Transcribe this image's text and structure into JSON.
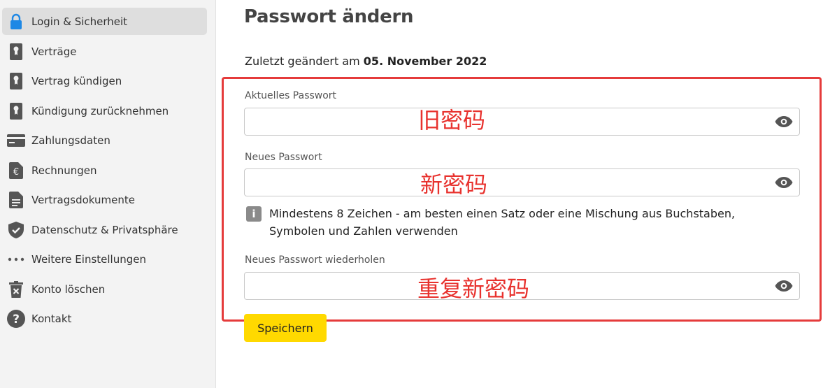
{
  "sidebar": {
    "items": [
      {
        "label": "Login & Sicherheit",
        "icon": "lock-icon",
        "active": true
      },
      {
        "label": "Verträge",
        "icon": "contract-icon"
      },
      {
        "label": "Vertrag kündigen",
        "icon": "contract-icon"
      },
      {
        "label": "Kündigung zurücknehmen",
        "icon": "contract-icon"
      },
      {
        "label": "Zahlungsdaten",
        "icon": "credit-card-icon"
      },
      {
        "label": "Rechnungen",
        "icon": "euro-document-icon"
      },
      {
        "label": "Vertragsdokumente",
        "icon": "document-icon"
      },
      {
        "label": "Datenschutz & Privatsphäre",
        "icon": "shield-check-icon"
      },
      {
        "label": "Weitere Einstellungen",
        "icon": "more-dots-icon"
      },
      {
        "label": "Konto löschen",
        "icon": "trash-icon"
      },
      {
        "label": "Kontakt",
        "icon": "help-icon"
      }
    ]
  },
  "main": {
    "title": "Passwort ändern",
    "last_changed_prefix": "Zuletzt geändert am",
    "last_changed_date": "05. November 2022",
    "fields": {
      "current": {
        "label": "Aktuelles Passwort",
        "value": "",
        "annotation": "旧密码"
      },
      "new": {
        "label": "Neues Passwort",
        "value": "",
        "annotation": "新密码"
      },
      "repeat": {
        "label": "Neues Passwort wiederholen",
        "value": "",
        "annotation": "重复新密码"
      }
    },
    "hint_icon_glyph": "i",
    "hint": "Mindestens 8 Zeichen - am besten einen Satz oder eine Mischung aus Buchstaben, Symbolen und Zahlen verwenden",
    "save_label": "Speichern"
  },
  "colors": {
    "accent": "#ffd900",
    "annotation": "#e53b3b",
    "icon": "#555555",
    "lock_icon": "#1e88e5"
  }
}
